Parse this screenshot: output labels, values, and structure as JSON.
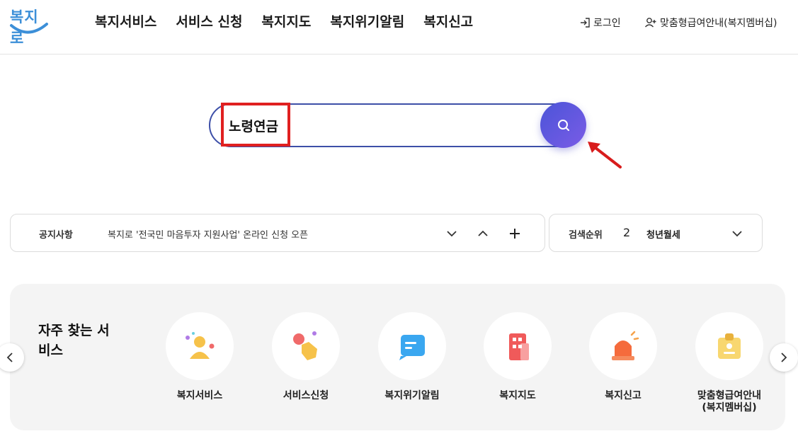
{
  "logo": {
    "text": "복지로"
  },
  "nav": [
    "복지서비스",
    "서비스 신청",
    "복지지도",
    "복지위기알림",
    "복지신고"
  ],
  "util": {
    "login": "로그인",
    "member": "맞춤형급여안내(복지멤버십)"
  },
  "search": {
    "value": "노령연금"
  },
  "notice": {
    "label": "공지사항",
    "text": "복지로 '전국민 마음투자 지원사업' 온라인 신청 오픈"
  },
  "rank": {
    "label": "검색순위",
    "number": "2",
    "text": "청년월세"
  },
  "services": {
    "title": "자주 찾는 서비스",
    "items": [
      {
        "label": "복지서비스",
        "icon": "person-icon"
      },
      {
        "label": "서비스신청",
        "icon": "tap-hand-icon"
      },
      {
        "label": "복지위기알림",
        "icon": "message-icon"
      },
      {
        "label": "복지지도",
        "icon": "building-icon"
      },
      {
        "label": "복지신고",
        "icon": "siren-icon"
      },
      {
        "label": "맞춤형급여안내\n(복지멤버십)",
        "icon": "id-card-icon"
      }
    ]
  },
  "colors": {
    "brand_blue": "#3c8fd8",
    "search_border": "#3d4fa8",
    "search_button": "#5b57dd",
    "highlight_red": "#e02020"
  }
}
